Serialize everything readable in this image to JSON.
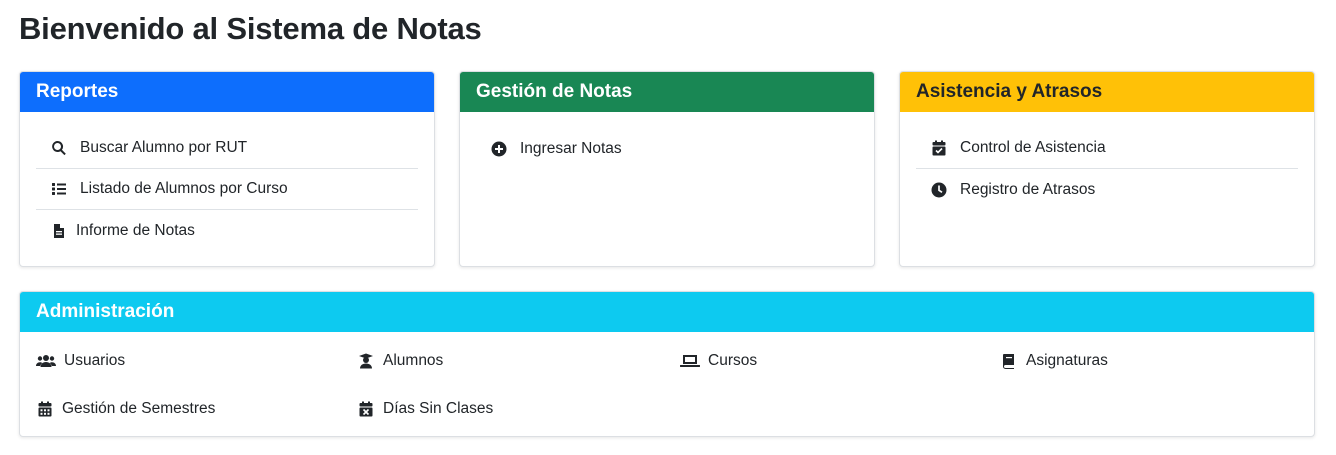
{
  "page": {
    "title": "Bienvenido al Sistema de Notas"
  },
  "reportes": {
    "title": "Reportes",
    "items": [
      {
        "label": "Buscar Alumno por RUT",
        "icon": "search-icon"
      },
      {
        "label": "Listado de Alumnos por Curso",
        "icon": "list-icon"
      },
      {
        "label": "Informe de Notas",
        "icon": "file-icon"
      }
    ]
  },
  "notas": {
    "title": "Gestión de Notas",
    "items": [
      {
        "label": "Ingresar Notas",
        "icon": "plus-circle-icon"
      }
    ]
  },
  "asistencia": {
    "title": "Asistencia y Atrasos",
    "items": [
      {
        "label": "Control de Asistencia",
        "icon": "calendar-check-icon"
      },
      {
        "label": "Registro de Atrasos",
        "icon": "clock-icon"
      }
    ]
  },
  "admin": {
    "title": "Administración",
    "items": [
      {
        "label": "Usuarios",
        "icon": "users-icon"
      },
      {
        "label": "Alumnos",
        "icon": "student-icon"
      },
      {
        "label": "Cursos",
        "icon": "laptop-icon"
      },
      {
        "label": "Asignaturas",
        "icon": "book-icon"
      },
      {
        "label": "Gestión de Semestres",
        "icon": "calendar-icon"
      },
      {
        "label": "Días Sin Clases",
        "icon": "calendar-x-icon"
      }
    ]
  },
  "colors": {
    "reportes": "#0d6efd",
    "notas": "#198754",
    "asistencia": "#ffc107",
    "admin": "#0dcaf0"
  }
}
